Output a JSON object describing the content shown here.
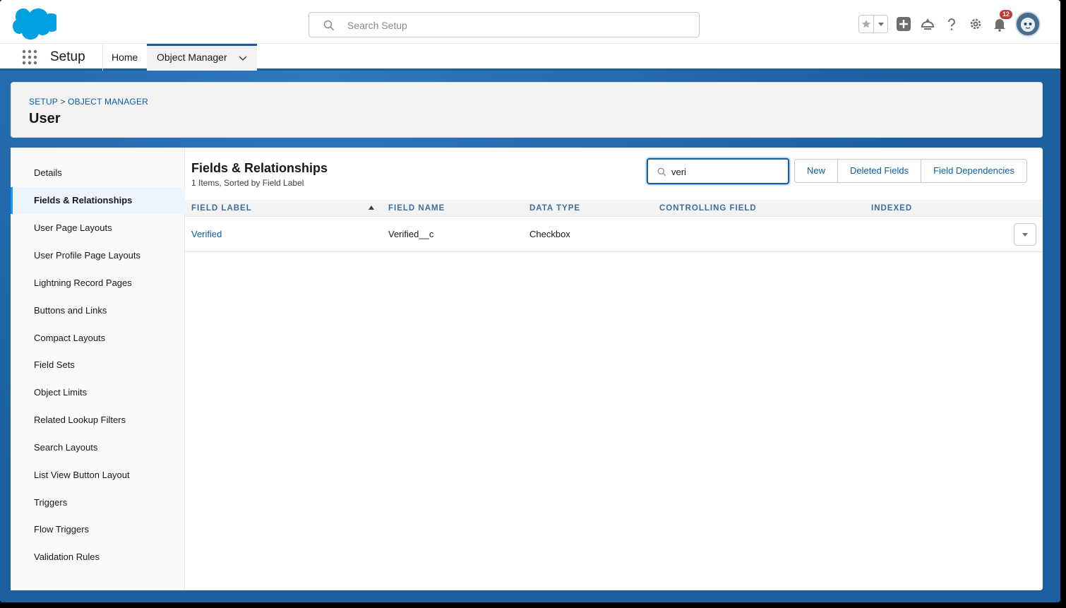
{
  "header": {
    "search_placeholder": "Search Setup",
    "notification_count": "12"
  },
  "app_nav": {
    "app_name": "Setup",
    "tabs": [
      {
        "label": "Home"
      },
      {
        "label": "Object Manager"
      }
    ]
  },
  "page_header": {
    "breadcrumb": [
      "SETUP",
      "OBJECT MANAGER"
    ],
    "breadcrumb_separator": ">",
    "title": "User"
  },
  "sidebar": {
    "items": [
      {
        "label": "Details"
      },
      {
        "label": "Fields & Relationships"
      },
      {
        "label": "User Page Layouts"
      },
      {
        "label": "User Profile Page Layouts"
      },
      {
        "label": "Lightning Record Pages"
      },
      {
        "label": "Buttons and Links"
      },
      {
        "label": "Compact Layouts"
      },
      {
        "label": "Field Sets"
      },
      {
        "label": "Object Limits"
      },
      {
        "label": "Related Lookup Filters"
      },
      {
        "label": "Search Layouts"
      },
      {
        "label": "List View Button Layout"
      },
      {
        "label": "Triggers"
      },
      {
        "label": "Flow Triggers"
      },
      {
        "label": "Validation Rules"
      }
    ],
    "active_index": 1
  },
  "main": {
    "title": "Fields & Relationships",
    "subtitle": "1 Items, Sorted by Field Label",
    "quick_find_value": "veri",
    "buttons": {
      "new": "New",
      "deleted_fields": "Deleted Fields",
      "field_dependencies": "Field Dependencies"
    },
    "table": {
      "columns": [
        "FIELD LABEL",
        "FIELD NAME",
        "DATA TYPE",
        "CONTROLLING FIELD",
        "INDEXED"
      ],
      "rows": [
        {
          "field_label": "Verified",
          "field_name": "Verified__c",
          "data_type": "Checkbox",
          "controlling_field": "",
          "indexed": ""
        }
      ]
    }
  },
  "colors": {
    "brand_blue": "#1b5f9e",
    "link_blue": "#0b5cab",
    "salesforce_cloud": "#00a1e0",
    "badge_red": "#c23934"
  }
}
